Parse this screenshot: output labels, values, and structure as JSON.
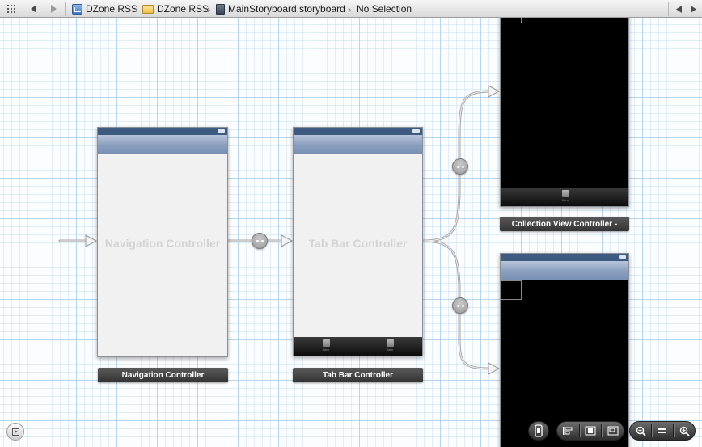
{
  "jumpbar": {
    "breadcrumbs": [
      {
        "label": "DZone RSS",
        "icon": "project-icon"
      },
      {
        "label": "DZone RSS",
        "icon": "folder-icon"
      },
      {
        "label": "MainStoryboard.storyboard",
        "icon": "storyboard-file-icon"
      },
      {
        "label": "No Selection",
        "icon": ""
      }
    ]
  },
  "scenes": {
    "navigation": {
      "placeholder": "Navigation Controller",
      "label": "Navigation Controller"
    },
    "tabbar": {
      "placeholder": "Tab Bar Controller",
      "label": "Tab Bar Controller",
      "tab_items": [
        "Item",
        "Item"
      ]
    },
    "collection": {
      "label": "Collection View Controller -",
      "tab_items": [
        "Item"
      ]
    }
  },
  "colors": {
    "canvas_grid": "#9ac3e6",
    "status_bar": "#3d5a80",
    "scene_label_bg": "#333333",
    "segue": "#a0a0a0"
  }
}
